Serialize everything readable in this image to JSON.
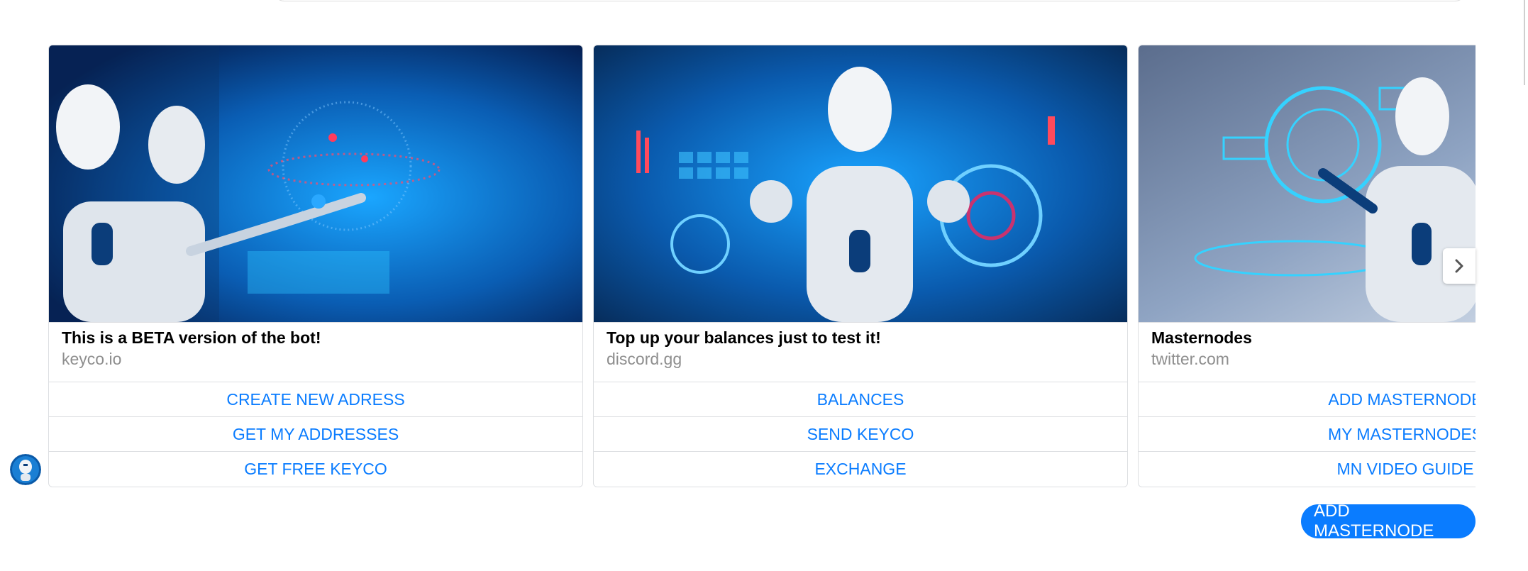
{
  "cards": [
    {
      "title": "This is a BETA version of the bot!",
      "subtitle": "keyco.io",
      "buttons": [
        "CREATE NEW ADRESS",
        "GET MY ADDRESSES",
        "GET FREE KEYCO"
      ]
    },
    {
      "title": "Top up your balances just to test it!",
      "subtitle": "discord.gg",
      "buttons": [
        "BALANCES",
        "SEND KEYCO",
        "EXCHANGE"
      ]
    },
    {
      "title": "Masternodes",
      "subtitle": "twitter.com",
      "buttons": [
        "ADD MASTERNODE",
        "MY MASTERNODES",
        "MN VIDEO GUIDE"
      ]
    }
  ],
  "quick_reply": {
    "label": "ADD MASTERNODE"
  },
  "colors": {
    "accent": "#0a7cff",
    "image_blue": "#0b4f9a",
    "image_grey": "#6e7f99"
  },
  "icons": {
    "next": "chevron-right-icon",
    "avatar": "robot-avatar-icon"
  }
}
